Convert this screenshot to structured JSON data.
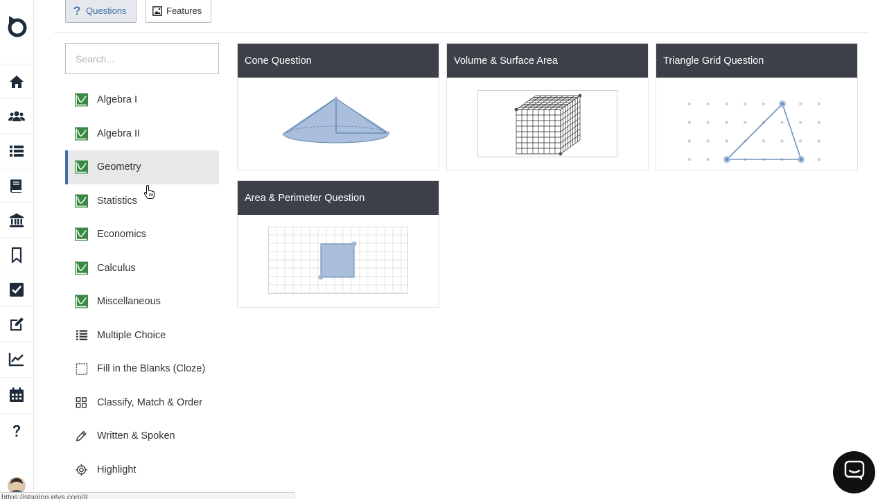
{
  "toolbar": {
    "questions_label": "Questions",
    "features_label": "Features"
  },
  "search": {
    "placeholder": "Search..."
  },
  "categories": [
    {
      "label": "Algebra I",
      "icon": "graph-icon"
    },
    {
      "label": "Algebra II",
      "icon": "graph-icon"
    },
    {
      "label": "Geometry",
      "icon": "graph-icon",
      "selected": true
    },
    {
      "label": "Statistics",
      "icon": "graph-icon"
    },
    {
      "label": "Economics",
      "icon": "graph-icon"
    },
    {
      "label": "Calculus",
      "icon": "graph-icon"
    },
    {
      "label": "Miscellaneous",
      "icon": "graph-icon"
    },
    {
      "label": "Multiple Choice",
      "icon": "list-icon"
    },
    {
      "label": "Fill in the Blanks (Cloze)",
      "icon": "dotted-box-icon"
    },
    {
      "label": "Classify, Match & Order",
      "icon": "grid-icon"
    },
    {
      "label": "Written & Spoken",
      "icon": "pencil-icon"
    },
    {
      "label": "Highlight",
      "icon": "target-icon"
    }
  ],
  "cards": [
    {
      "title": "Cone Question"
    },
    {
      "title": "Volume & Surface Area"
    },
    {
      "title": "Triangle Grid Question"
    },
    {
      "title": "Area & Perimeter Question"
    }
  ],
  "status_url": "https://staging.etys.com/#",
  "colors": {
    "accent": "#3f6fa5",
    "card_header": "#3d4049",
    "graph_icon_green": "#3a8a45",
    "shape_fill": "#aabfdc",
    "shape_stroke": "#5f83b1",
    "rail_icon": "#1d2b3a"
  }
}
